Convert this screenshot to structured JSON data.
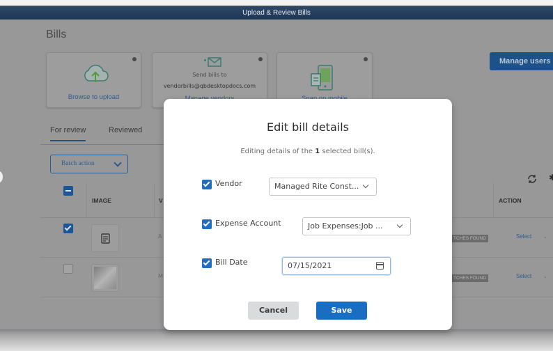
{
  "window": {
    "title": "Upload & Review Bills"
  },
  "page": {
    "title": "Bills"
  },
  "cards": {
    "upload": {
      "label": "Browse to upload"
    },
    "email": {
      "line1": "Send bills to",
      "email": "vendorbills@qbdesktopdocs.com",
      "link": "Manage vendors"
    },
    "mobile": {
      "label": "Snap on mobile"
    }
  },
  "manage_users": "Manage users",
  "tabs": [
    {
      "label": "For review",
      "active": true
    },
    {
      "label": "Reviewed",
      "active": false
    }
  ],
  "batch_action": "Batch action",
  "table": {
    "headers": {
      "image": "IMAGE",
      "vendor": "V",
      "action": "ACTION"
    },
    "rows": [
      {
        "checked": true,
        "vendor_hint": "A",
        "badge": "TCHES FOUND",
        "action": "Select"
      },
      {
        "checked": false,
        "vendor_hint": "M",
        "badge": "TCHES FOUND",
        "action": "Select"
      }
    ]
  },
  "modal": {
    "title": "Edit bill details",
    "subtitle_pre": "Editing details of the ",
    "subtitle_count": "1",
    "subtitle_post": " selected bill(s).",
    "fields": {
      "vendor": {
        "label": "Vendor",
        "checked": true,
        "value": "Managed Rite Const..."
      },
      "expense": {
        "label": "Expense Account",
        "checked": true,
        "value": "Job Expenses:Job ..."
      },
      "date": {
        "label": "Bill Date",
        "checked": true,
        "value": "07/15/2021"
      }
    },
    "cancel": "Cancel",
    "save": "Save"
  }
}
